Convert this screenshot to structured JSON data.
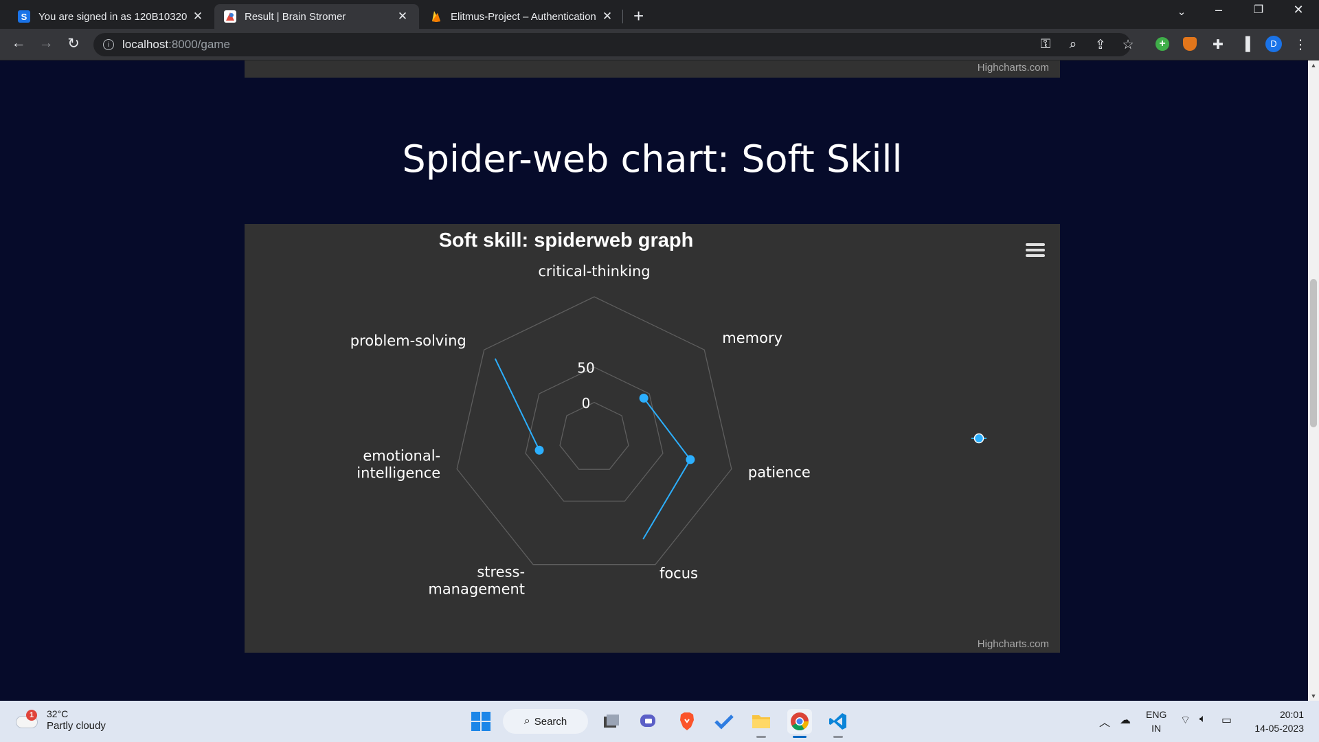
{
  "browser": {
    "tabs": [
      {
        "title": "You are signed in as 120B10320",
        "favicon": "S",
        "active": false
      },
      {
        "title": "Result | Brain Stromer",
        "favicon": "",
        "active": true
      },
      {
        "title": "Elitmus-Project – Authentication",
        "favicon": "",
        "active": false
      }
    ],
    "url_host": "localhost",
    "url_path": ":8000/game",
    "profile_initial": "D"
  },
  "page": {
    "top_chart_credit": "Highcharts.com",
    "section_title": "Spider-web chart: Soft Skill",
    "chart_credit": "Highcharts.com"
  },
  "chart_data": {
    "type": "radar",
    "title": "Soft skill: spiderweb graph",
    "categories": [
      "critical-thinking",
      "memory",
      "patience",
      "focus",
      "stress-management",
      "emotional-intelligence",
      "problem-solving"
    ],
    "category_lines": [
      [
        "critical-thinking"
      ],
      [
        "memory"
      ],
      [
        "patience"
      ],
      [
        "focus"
      ],
      [
        "stress-",
        "management"
      ],
      [
        "emotional-",
        "intelligence"
      ],
      [
        "problem-solving"
      ]
    ],
    "series": [
      {
        "values": [
          null,
          40,
          90,
          110,
          null,
          30,
          130
        ],
        "color": "#2caffe"
      }
    ],
    "radial_ticks": [
      0,
      50
    ],
    "radial_range": [
      -50,
      150
    ],
    "background": "#323232",
    "grid_color": "#5e5e5e"
  },
  "taskbar": {
    "weather_temp": "32°C",
    "weather_condition": "Partly cloudy",
    "weather_badge": "1",
    "search_label": "Search",
    "lang_line1": "ENG",
    "lang_line2": "IN",
    "time": "20:01",
    "date": "14-05-2023"
  }
}
